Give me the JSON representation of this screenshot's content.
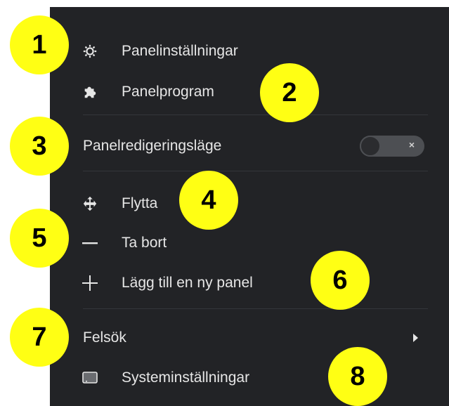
{
  "menu": {
    "items": [
      {
        "label": "Panelinställningar",
        "icon": "gear-icon"
      },
      {
        "label": "Panelprogram",
        "icon": "puzzle-icon"
      },
      {
        "label": "Panelredigeringsläge",
        "toggle": "off"
      },
      {
        "label": "Flytta",
        "icon": "move-icon"
      },
      {
        "label": "Ta bort",
        "icon": "minus-icon"
      },
      {
        "label": "Lägg till en ny panel",
        "icon": "plus-icon"
      },
      {
        "label": "Felsök",
        "submenu": true
      },
      {
        "label": "Systeminställningar",
        "icon": "system-settings-icon"
      }
    ],
    "toggle_off_glyph": "×"
  },
  "callouts": [
    "1",
    "2",
    "3",
    "4",
    "5",
    "6",
    "7",
    "8"
  ],
  "colors": {
    "menu_bg": "#222326",
    "callout": "#ffff14",
    "text": "#e6e6e6"
  }
}
